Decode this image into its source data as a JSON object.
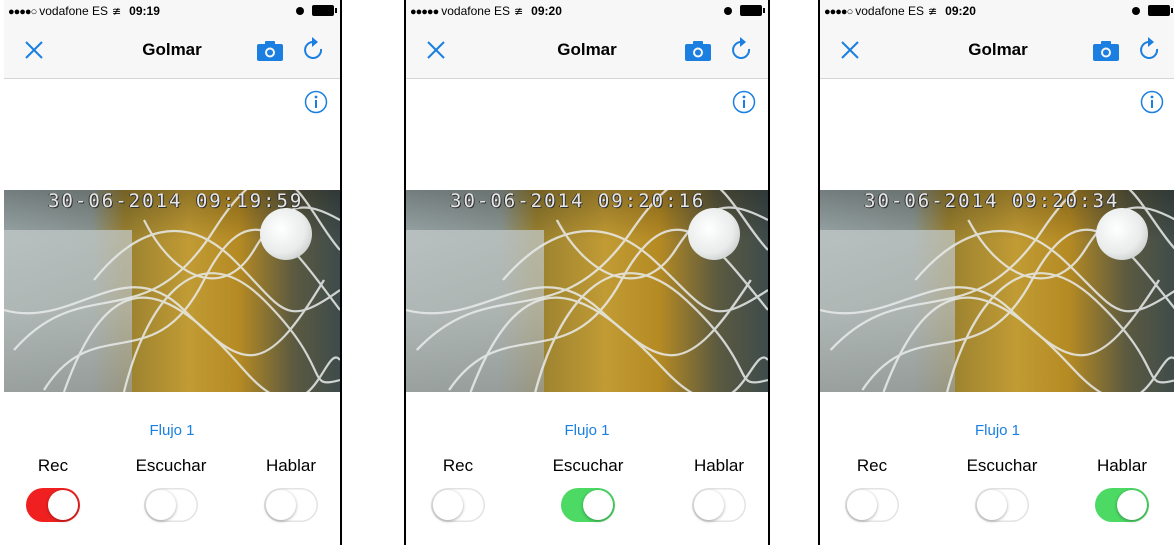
{
  "screens": [
    {
      "status": {
        "signal": "●●●●○",
        "carrier": "vodafone ES",
        "time": "09:19"
      },
      "nav": {
        "title": "Golmar"
      },
      "video": {
        "timestamp": "30-06-2014 09:19:59"
      },
      "stream_label": "Flujo 1",
      "controls": [
        {
          "label": "Rec",
          "state": "on",
          "color": "#f02020"
        },
        {
          "label": "Escuchar",
          "state": "off"
        },
        {
          "label": "Hablar",
          "state": "off"
        }
      ]
    },
    {
      "status": {
        "signal": "●●●●●",
        "carrier": "vodafone ES",
        "time": "09:20"
      },
      "nav": {
        "title": "Golmar"
      },
      "video": {
        "timestamp": "30-06-2014 09:20:16"
      },
      "stream_label": "Flujo 1",
      "controls": [
        {
          "label": "Rec",
          "state": "off"
        },
        {
          "label": "Escuchar",
          "state": "on",
          "color": "#4cd964"
        },
        {
          "label": "Hablar",
          "state": "off"
        }
      ]
    },
    {
      "status": {
        "signal": "●●●●○",
        "carrier": "vodafone ES",
        "time": "09:20"
      },
      "nav": {
        "title": "Golmar"
      },
      "video": {
        "timestamp": "30-06-2014 09:20:34"
      },
      "stream_label": "Flujo 1",
      "controls": [
        {
          "label": "Rec",
          "state": "off"
        },
        {
          "label": "Escuchar",
          "state": "off"
        },
        {
          "label": "Hablar",
          "state": "on",
          "color": "#4cd964"
        }
      ]
    }
  ],
  "icons": {
    "close": "close-icon",
    "camera": "camera-icon",
    "refresh": "refresh-icon",
    "info": "info-icon",
    "wifi": "wifi-icon",
    "alarm": "alarm-icon",
    "battery": "battery-icon"
  },
  "colors": {
    "accent": "#1a7fe0",
    "rec_on": "#f02020",
    "audio_on": "#4cd964"
  }
}
